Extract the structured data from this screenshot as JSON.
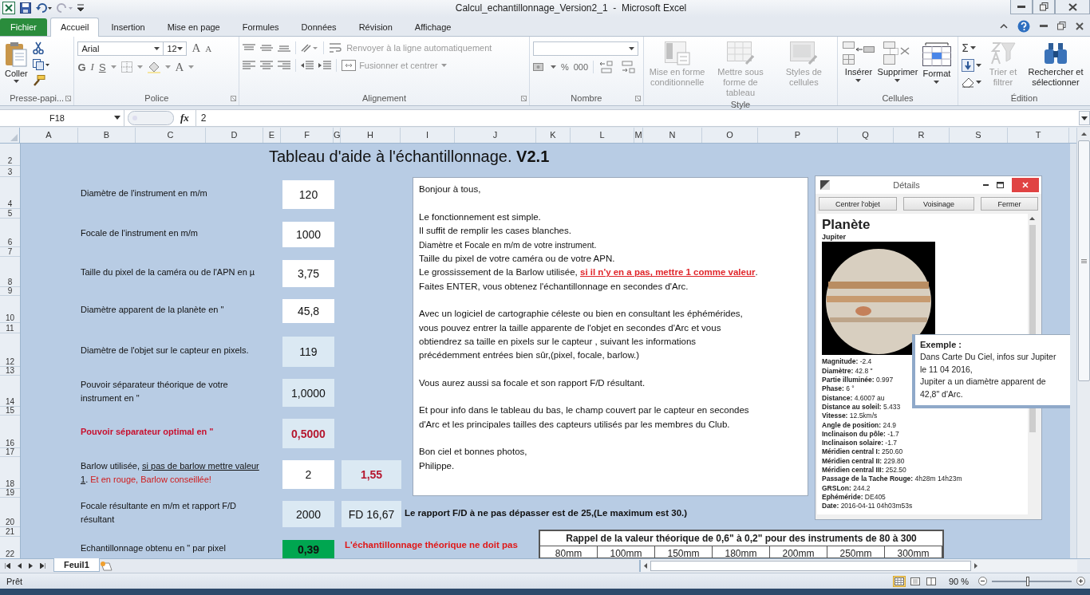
{
  "window": {
    "title": "Calcul_echantillonnage_Version2_1  -  Microsoft Excel"
  },
  "ribbon_tabs": [
    {
      "label": "Fichier",
      "kind": "file",
      "selected": false
    },
    {
      "label": "Accueil",
      "kind": "tab",
      "selected": true
    },
    {
      "label": "Insertion",
      "kind": "tab",
      "selected": false
    },
    {
      "label": "Mise en page",
      "kind": "tab",
      "selected": false
    },
    {
      "label": "Formules",
      "kind": "tab",
      "selected": false
    },
    {
      "label": "Données",
      "kind": "tab",
      "selected": false
    },
    {
      "label": "Révision",
      "kind": "tab",
      "selected": false
    },
    {
      "label": "Affichage",
      "kind": "tab",
      "selected": false
    }
  ],
  "ribbon": {
    "clipboard": {
      "paste": "Coller",
      "label": "Presse-papi..."
    },
    "font": {
      "name": "Arial",
      "size": "12",
      "grow": "A",
      "shrink": "A",
      "bold": "G",
      "italic": "I",
      "underline": "S",
      "color_button": "A",
      "label": "Police"
    },
    "alignment": {
      "wrap": {
        "label": "Renvoyer à la ligne automatiquement",
        "disabled": true
      },
      "merge": {
        "label": "Fusionner et centrer",
        "disabled": true
      },
      "label": "Alignement"
    },
    "number": {
      "percent": "%",
      "thousands": "000",
      "label": "Nombre"
    },
    "style": {
      "buttons": [
        {
          "label": "Mise en forme conditionnelle",
          "disabled": true
        },
        {
          "label": "Mettre sous forme de tableau",
          "disabled": true
        },
        {
          "label": "Styles de cellules",
          "disabled": true
        }
      ],
      "label": "Style"
    },
    "cells": {
      "buttons": [
        {
          "label": "Insérer",
          "disabled": false
        },
        {
          "label": "Supprimer",
          "disabled": false
        },
        {
          "label": "Format",
          "disabled": false
        }
      ],
      "label": "Cellules"
    },
    "editing": {
      "sum": "Σ",
      "buttons": [
        {
          "label": "Trier et filtrer",
          "disabled": true
        },
        {
          "label": "Rechercher et sélectionner",
          "disabled": false
        }
      ],
      "label": "Édition"
    }
  },
  "formula_bar": {
    "name_box": "F18",
    "fx": "fx",
    "value": "2"
  },
  "sheet": {
    "columns": [
      "A",
      "B",
      "C",
      "D",
      "E",
      "F",
      "G",
      "H",
      "I",
      "J",
      "K",
      "L",
      "M",
      "N",
      "O",
      "P",
      "Q",
      "R",
      "S",
      "T"
    ],
    "rows": [
      "2",
      "3",
      "4",
      "5",
      "6",
      "7",
      "8",
      "9",
      "10",
      "11",
      "12",
      "13",
      "14",
      "15",
      "16",
      "17",
      "18",
      "19",
      "20",
      "21",
      "22"
    ],
    "title": "Tableau d'aide à l'échantillonnage. **V2.1**",
    "form": [
      {
        "label": [
          {
            "text": "Diamètre de l'instrument en m/m",
            "kind": "plain"
          }
        ],
        "value": "120",
        "kind": "input"
      },
      {
        "label": [
          {
            "text": "Focale de l'instrument en m/m",
            "kind": "plain"
          }
        ],
        "value": "1000",
        "kind": "input"
      },
      {
        "label": [
          {
            "text": "Taille du pixel de la caméra ou de l'APN en µ",
            "kind": "plain"
          }
        ],
        "value": "3,75",
        "kind": "input"
      },
      {
        "label": [
          {
            "text": "Diamètre apparent de la planète en \"",
            "kind": "plain"
          }
        ],
        "value": "45,8",
        "kind": "input"
      },
      {
        "label": [
          {
            "text": "Diamètre de l'objet sur le capteur en pixels.",
            "kind": "plain"
          }
        ],
        "value": "119",
        "kind": "result"
      },
      {
        "label": [
          {
            "text": "Pouvoir séparateur théorique de votre instrument en \"",
            "kind": "plain"
          }
        ],
        "value": "1,0000",
        "kind": "result"
      },
      {
        "label": [
          {
            "text": "Pouvoir séparateur optimal en \"",
            "kind": "alert"
          }
        ],
        "value": "0,5000",
        "kind": "alert"
      },
      {
        "label": [
          {
            "text": "Barlow utilisée, ",
            "kind": "plain"
          },
          {
            "text": "si pas de barlow mettre valeur 1",
            "kind": "underline"
          },
          {
            "text": ". ",
            "kind": "plain"
          },
          {
            "text": "Et en rouge, Barlow conseillée!",
            "kind": "red"
          }
        ],
        "value": "2",
        "kind": "input",
        "extra": {
          "value": "1,55",
          "kind": "alert"
        }
      },
      {
        "label": [
          {
            "text": "Focale résultante en m/m et rapport F/D résultant",
            "kind": "plain"
          }
        ],
        "value": "2000",
        "kind": "result",
        "extra": {
          "value": "FD  16,67",
          "kind": "result"
        },
        "note": {
          "text": "Le rapport F/D à ne pas dépasser est de 25,(Le maximum est 30.)",
          "kind": "note"
        }
      },
      {
        "label": [
          {
            "text": "Echantillonnage obtenu en \" par pixel",
            "kind": "plain"
          }
        ],
        "value": "0,39",
        "kind": "good",
        "note": {
          "text": "L'échantillonnage théorique ne doit pas",
          "kind": "warning"
        }
      }
    ],
    "reference_table": {
      "title": "Rappel de la valeur théorique de 0,6\" à 0,2\" pour des instruments de 80 à 300",
      "headers": [
        "80mm",
        "100mm",
        "150mm",
        "180mm",
        "200mm",
        "250mm",
        "300mm"
      ]
    },
    "text_box": [
      [
        [
          {
            "text": "Bonjour à tous,",
            "kind": "plain"
          }
        ]
      ],
      [
        [
          {
            "text": "Le fonctionnement est simple.",
            "kind": "plain"
          }
        ],
        [
          {
            "text": "Il suffit de remplir les cases blanches.",
            "kind": "plain"
          }
        ],
        [
          {
            "text": "Diamètre et Focale en m/m de votre instrument.",
            "kind": "small"
          }
        ],
        [
          {
            "text": "Taille du pixel de votre caméra ou de votre APN.",
            "kind": "plain"
          }
        ],
        [
          {
            "text": "Le grossissement de la Barlow utilisée, ",
            "kind": "plain"
          },
          {
            "text": "si il n'y en a pas, mettre 1 comme valeur",
            "kind": "emph"
          },
          {
            "text": ".",
            "kind": "plain"
          }
        ],
        [
          {
            "text": "Faites ENTER, vous obtenez l'échantillonnage en secondes d'Arc.",
            "kind": "plain"
          }
        ]
      ],
      [
        [
          {
            "text": "Avec un logiciel de cartographie céleste ou bien en consultant les éphémérides,",
            "kind": "plain"
          }
        ],
        [
          {
            "text": "vous pouvez entrer la taille apparente de l'objet en secondes d'Arc et vous",
            "kind": "plain"
          }
        ],
        [
          {
            "text": "obtiendrez sa taille en pixels sur le capteur , suivant les informations",
            "kind": "plain"
          }
        ],
        [
          {
            "text": "précédemment entrées bien sûr,(pixel, focale, barlow.)",
            "kind": "plain"
          }
        ]
      ],
      [
        [
          {
            "text": "Vous aurez aussi sa focale et son rapport F/D résultant.",
            "kind": "plain"
          }
        ]
      ],
      [
        [
          {
            "text": "Et pour info dans le tableau du bas, le champ couvert par le capteur en secondes",
            "kind": "plain"
          }
        ],
        [
          {
            "text": "d'Arc et les principales tailles des capteurs utilisés par les membres du Club.",
            "kind": "plain"
          }
        ]
      ],
      [
        [
          {
            "text": "Bon ciel et bonnes photos,",
            "kind": "plain"
          }
        ],
        [
          {
            "text": "Philippe.",
            "kind": "plain"
          }
        ]
      ]
    ],
    "details_window": {
      "title": "Détails",
      "buttons": [
        "Centrer l'objet",
        "Voisinage",
        "Fermer"
      ],
      "heading": "Planète",
      "name": "Jupiter",
      "properties": [
        {
          "label": "Magnitude:",
          "value": "-2.4"
        },
        {
          "label": "Diamètre:",
          "value": "42.8 \""
        },
        {
          "label": "Partie illuminée:",
          "value": "0.997"
        },
        {
          "label": "Phase:",
          "value": "6 °"
        },
        {
          "label": "Distance:",
          "value": "4.6007 au"
        },
        {
          "label": "Distance au soleil:",
          "value": "5.433"
        },
        {
          "label": "Vitesse:",
          "value": "12.5km/s"
        },
        {
          "label": "Angle de position:",
          "value": "24.9"
        },
        {
          "label": "Inclinaison du pôle:",
          "value": "-1.7"
        },
        {
          "label": "Inclinaison solaire:",
          "value": "-1.7"
        },
        {
          "label": "Méridien central I:",
          "value": "250.60"
        },
        {
          "label": "Méridien central II:",
          "value": "229.80"
        },
        {
          "label": "Méridien central III:",
          "value": "252.50"
        },
        {
          "label": "Passage de la Tache Rouge:",
          "value": "4h28m 14h23m"
        },
        {
          "label": "GRSLon:",
          "value": "244.2"
        },
        {
          "label": "Ephéméride:",
          "value": "DE405"
        },
        {
          "label": "Date:",
          "value": "2016-04-11 04h03m53s"
        }
      ]
    },
    "example_note": {
      "title": "Exemple :",
      "text": "Dans Carte Du Ciel, infos sur Jupiter\nle 11 04 2016,\n Jupiter a un diamètre apparent de\n42,8\" d'Arc."
    }
  },
  "sheet_tabs": [
    {
      "label": "Feuil1",
      "selected": true
    }
  ],
  "status_bar": {
    "text": "Prêt",
    "views": [
      {
        "selected": true
      },
      {
        "selected": false
      },
      {
        "selected": false
      }
    ],
    "zoom": {
      "label": "90 %",
      "level": 0.45
    }
  }
}
